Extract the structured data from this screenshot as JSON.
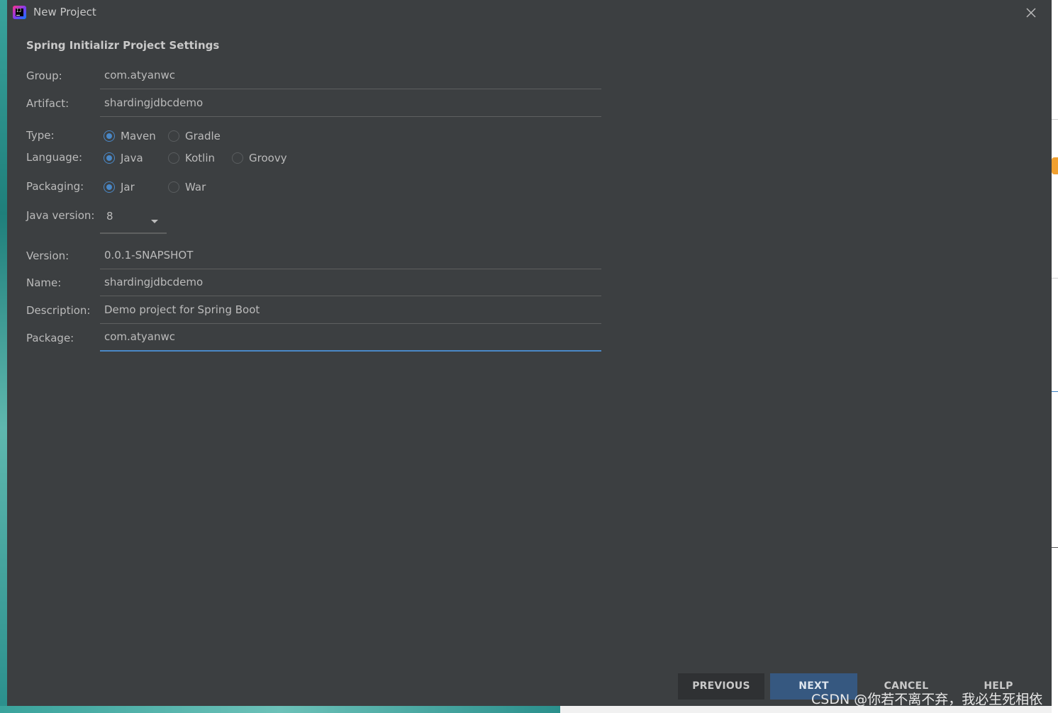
{
  "window": {
    "title": "New Project"
  },
  "section_title": "Spring Initializr Project Settings",
  "fields": {
    "group": {
      "label": "Group:",
      "value": "com.atyanwc"
    },
    "artifact": {
      "label": "Artifact:",
      "value": "shardingjdbcdemo"
    },
    "version": {
      "label": "Version:",
      "value": "0.0.1-SNAPSHOT"
    },
    "name": {
      "label": "Name:",
      "value": "shardingjdbcdemo"
    },
    "description": {
      "label": "Description:",
      "value": "Demo project for Spring Boot"
    },
    "package": {
      "label": "Package:",
      "value": "com.atyanwc"
    }
  },
  "type": {
    "label": "Type:",
    "options": [
      "Maven",
      "Gradle"
    ],
    "selected": "Maven"
  },
  "language": {
    "label": "Language:",
    "options": [
      "Java",
      "Kotlin",
      "Groovy"
    ],
    "selected": "Java"
  },
  "packaging": {
    "label": "Packaging:",
    "options": [
      "Jar",
      "War"
    ],
    "selected": "Jar"
  },
  "java_version": {
    "label": "Java version:",
    "value": "8"
  },
  "buttons": {
    "previous": "PREVIOUS",
    "next": "NEXT",
    "cancel": "CANCEL",
    "help": "HELP"
  },
  "watermark": "CSDN @你若不离不弃，我必生死相依",
  "icons": {
    "app": "intellij-idea-icon",
    "close": "close-icon",
    "dropdown": "chevron-down-icon"
  },
  "colors": {
    "dialog_bg": "#3c3f41",
    "accent": "#4a88c7",
    "primary_button": "#365880"
  }
}
